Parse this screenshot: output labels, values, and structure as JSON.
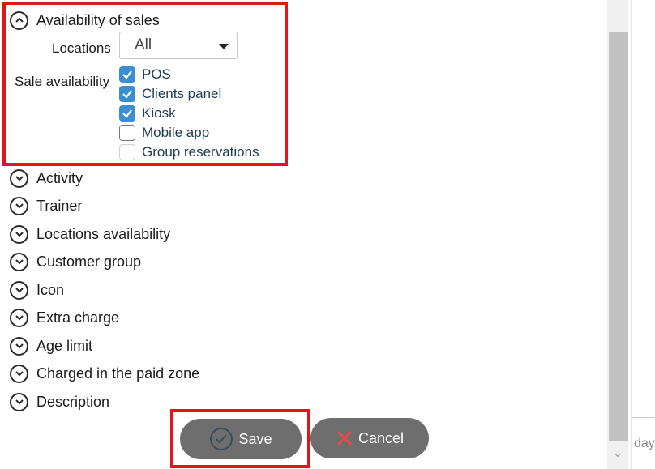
{
  "sections": {
    "availability": {
      "title": "Availability of sales",
      "expanded": true
    },
    "collapsed": [
      {
        "title": "Activity"
      },
      {
        "title": "Trainer"
      },
      {
        "title": "Locations availability"
      },
      {
        "title": "Customer group"
      },
      {
        "title": "Icon"
      },
      {
        "title": "Extra charge"
      },
      {
        "title": "Age limit"
      },
      {
        "title": "Charged in the paid zone"
      },
      {
        "title": "Description"
      }
    ]
  },
  "availability": {
    "locations_label": "Locations",
    "locations_value": "All",
    "sale_availability_label": "Sale availability",
    "options": [
      {
        "label": "POS",
        "checked": true
      },
      {
        "label": "Clients panel",
        "checked": true
      },
      {
        "label": "Kiosk",
        "checked": true
      },
      {
        "label": "Mobile app",
        "checked": false
      },
      {
        "label": "Group reservations",
        "checked": false
      }
    ]
  },
  "buttons": {
    "save": "Save",
    "cancel": "Cancel"
  },
  "right_strip_text": "day",
  "colors": {
    "highlight": "#e0161d",
    "checkbox": "#3a8fd0",
    "button": "#6e6e6e",
    "cancel_icon": "#e84a4a"
  },
  "icons": {
    "expand": "chevron-down-icon",
    "collapse": "chevron-up-icon",
    "save": "check-circle-icon",
    "cancel": "x-icon"
  }
}
